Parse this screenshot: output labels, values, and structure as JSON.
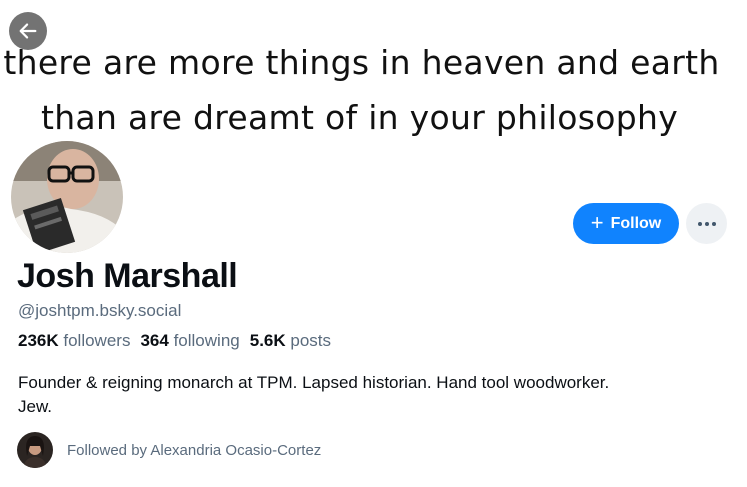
{
  "banner": {
    "line1": "there are more things in heaven and earth",
    "line2": "than are dreamt of in your philosophy"
  },
  "profile": {
    "display_name": "Josh Marshall",
    "handle": "@joshtpm.bsky.social",
    "followers_count": "236K",
    "followers_label": "followers",
    "following_count": "364",
    "following_label": "following",
    "posts_count": "5.6K",
    "posts_label": "posts",
    "bio_line1": "Founder & reigning monarch at TPM. Lapsed historian. Hand tool woodworker.",
    "bio_line2": "Jew."
  },
  "actions": {
    "follow_label": "Follow",
    "more_icon": "ellipsis-icon",
    "back_icon": "arrow-left-icon"
  },
  "followed_by": {
    "text": "Followed by Alexandria Ocasio-Cortez"
  },
  "colors": {
    "accent": "#1083fe",
    "muted_text": "#5a6b7d",
    "text": "#0b0f14"
  }
}
